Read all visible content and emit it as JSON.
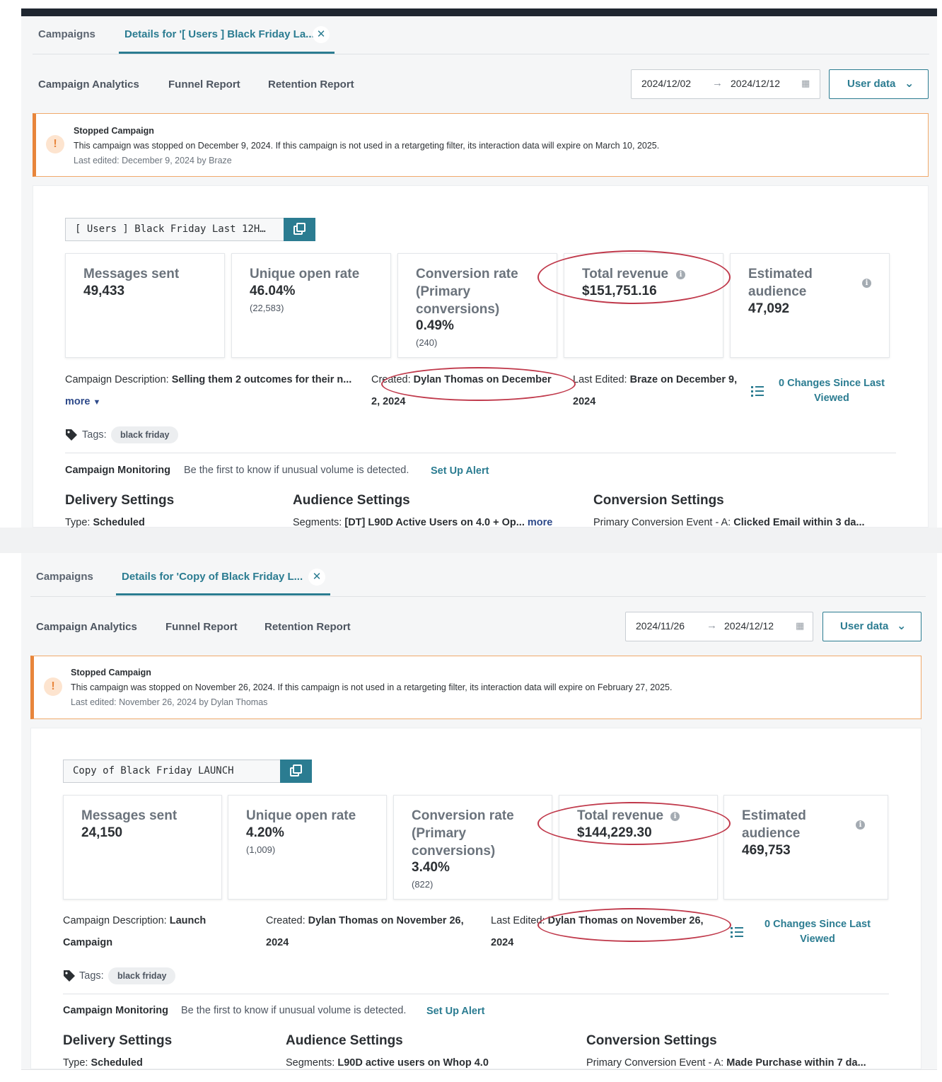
{
  "annotation_color": "#c0394b",
  "accent_color": "#2b7c91",
  "panels": [
    {
      "tabs": {
        "campaigns": "Campaigns",
        "details": "Details for '[ Users ] Black Friday La..."
      },
      "subnav": {
        "analytics": "Campaign Analytics",
        "funnel": "Funnel Report",
        "retention": "Retention Report"
      },
      "date_range": {
        "start": "2024/12/02",
        "end": "2024/12/12"
      },
      "user_data_label": "User data",
      "alert": {
        "title": "Stopped Campaign",
        "text": "This campaign was stopped on December 9, 2024. If this campaign is not used in a retargeting filter, its interaction data will expire on March 10, 2025.",
        "sub": "Last edited: December 9, 2024 by Braze"
      },
      "campaign_name": "[ Users ] Black Friday Last 12H…",
      "metrics": {
        "messages": {
          "label": "Messages sent",
          "value": "49,433"
        },
        "open_rate": {
          "label": "Unique open rate",
          "value": "46.04%",
          "sub": "(22,583)"
        },
        "conversion": {
          "label": "Conversion rate (Primary conversions)",
          "value": "0.49%",
          "sub": "(240)"
        },
        "revenue": {
          "label": "Total revenue",
          "value": "$151,751.16"
        },
        "audience": {
          "label": "Estimated audience",
          "value": "47,092"
        }
      },
      "meta": {
        "description_label": "Campaign Description:",
        "description_value": "Selling them 2 outcomes for their n...",
        "more": "more",
        "created_label": "Created:",
        "created_value_1": "Dylan Thomas on December",
        "created_value_2": "2, 2024",
        "edited_label": "Last Edited:",
        "edited_value_1": "Braze on December 9,",
        "edited_value_2": "2024",
        "changes": "0 Changes Since Last Viewed"
      },
      "tags_label": "Tags:",
      "tag": "black friday",
      "monitoring": {
        "label": "Campaign Monitoring",
        "text": "Be the first to know if unusual volume is detected.",
        "link": "Set Up Alert"
      },
      "settings": {
        "delivery_title": "Delivery Settings",
        "delivery_label": "Type:",
        "delivery_value": "Scheduled",
        "audience_title": "Audience Settings",
        "audience_label": "Segments:",
        "audience_value": "[DT] L90D Active Users on 4.0 + Op...",
        "audience_more": "more",
        "conversion_title": "Conversion Settings",
        "conversion_label": "Primary Conversion Event - A:",
        "conversion_value": "Clicked Email within 3 da..."
      }
    },
    {
      "tabs": {
        "campaigns": "Campaigns",
        "details": "Details for 'Copy of Black Friday L..."
      },
      "subnav": {
        "analytics": "Campaign Analytics",
        "funnel": "Funnel Report",
        "retention": "Retention Report"
      },
      "date_range": {
        "start": "2024/11/26",
        "end": "2024/12/12"
      },
      "user_data_label": "User data",
      "alert": {
        "title": "Stopped Campaign",
        "text": "This campaign was stopped on November 26, 2024. If this campaign is not used in a retargeting filter, its interaction data will expire on February 27, 2025.",
        "sub": "Last edited: November 26, 2024 by Dylan Thomas"
      },
      "campaign_name": "Copy of Black Friday LAUNCH",
      "metrics": {
        "messages": {
          "label": "Messages sent",
          "value": "24,150"
        },
        "open_rate": {
          "label": "Unique open rate",
          "value": "4.20%",
          "sub": "(1,009)"
        },
        "conversion": {
          "label": "Conversion rate (Primary conversions)",
          "value": "3.40%",
          "sub": "(822)"
        },
        "revenue": {
          "label": "Total revenue",
          "value": "$144,229.30"
        },
        "audience": {
          "label": "Estimated audience",
          "value": "469,753"
        }
      },
      "meta": {
        "description_label": "Campaign Description:",
        "description_value_1": "Launch",
        "description_value_2": "Campaign",
        "created_label": "Created:",
        "created_value_1": "Dylan Thomas on November 26,",
        "created_value_2": "2024",
        "edited_label": "Last Edited:",
        "edited_value_1": "Dylan Thomas on November 26,",
        "edited_value_2": "2024",
        "changes": "0 Changes Since Last Viewed"
      },
      "tags_label": "Tags:",
      "tag": "black friday",
      "monitoring": {
        "label": "Campaign Monitoring",
        "text": "Be the first to know if unusual volume is detected.",
        "link": "Set Up Alert"
      },
      "settings": {
        "delivery_title": "Delivery Settings",
        "delivery_label": "Type:",
        "delivery_value": "Scheduled",
        "audience_title": "Audience Settings",
        "audience_label": "Segments:",
        "audience_value": "L90D active users on Whop 4.0",
        "conversion_title": "Conversion Settings",
        "conversion_label": "Primary Conversion Event - A:",
        "conversion_value": "Made Purchase within 7 da..."
      }
    }
  ]
}
